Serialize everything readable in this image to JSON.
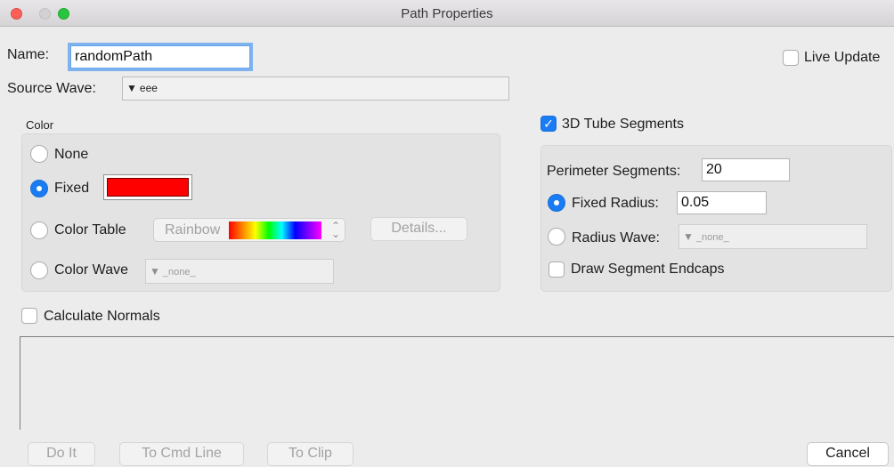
{
  "window": {
    "title": "Path Properties"
  },
  "name": {
    "label": "Name:",
    "value": "randomPath"
  },
  "live_update": {
    "label": "Live Update",
    "checked": false
  },
  "source_wave": {
    "label": "Source Wave:",
    "value": "eee"
  },
  "color_group": {
    "title": "Color",
    "options": {
      "none": "None",
      "fixed": "Fixed",
      "color_table": "Color Table",
      "color_wave": "Color Wave"
    },
    "selected": "fixed",
    "fixed_color": "#ff0000",
    "color_table_value": "Rainbow",
    "details_button": "Details...",
    "color_wave_value": "_none_"
  },
  "tube": {
    "label": "3D Tube Segments",
    "checked": true,
    "perimeter_label": "Perimeter Segments:",
    "perimeter_value": "20",
    "fixed_radius_label": "Fixed Radius:",
    "fixed_radius_value": "0.05",
    "radius_wave_label": "Radius Wave:",
    "radius_wave_value": "_none_",
    "selected": "fixed_radius",
    "endcaps_label": "Draw Segment Endcaps",
    "endcaps_checked": false
  },
  "calculate_normals": {
    "label": "Calculate Normals",
    "checked": false
  },
  "buttons": {
    "do_it": "Do It",
    "to_cmd_line": "To Cmd Line",
    "to_clip": "To Clip",
    "cancel": "Cancel"
  }
}
